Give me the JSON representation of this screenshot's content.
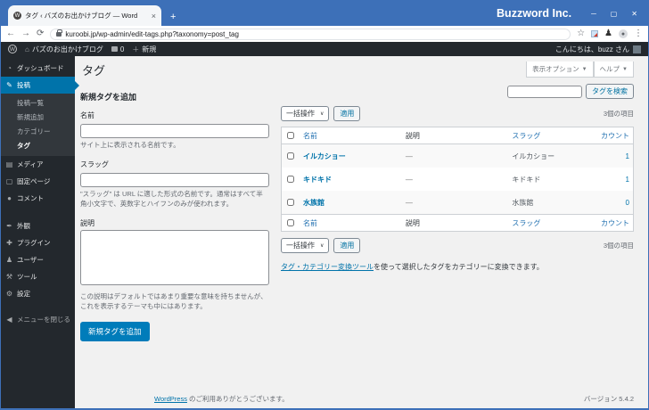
{
  "browser": {
    "tab_title": "タグ ‹ バズのお出かけブログ — Word",
    "window_title": "Buzzword Inc.",
    "url": "kuroobi.jp/wp-admin/edit-tags.php?taxonomy=post_tag"
  },
  "admin_bar": {
    "wp_initial": "W",
    "site_name": "バズのお出かけブログ",
    "comments_count": "0",
    "new_label": "新規",
    "greeting": "こんにちは、buzz さん"
  },
  "sidebar": {
    "items": [
      {
        "label": "ダッシュボード"
      },
      {
        "label": "投稿"
      },
      {
        "label": "メディア"
      },
      {
        "label": "固定ページ"
      },
      {
        "label": "コメント"
      },
      {
        "label": "外観"
      },
      {
        "label": "プラグイン"
      },
      {
        "label": "ユーザー"
      },
      {
        "label": "ツール"
      },
      {
        "label": "設定"
      }
    ],
    "posts_submenu": [
      "投稿一覧",
      "新規追加",
      "カテゴリー",
      "タグ"
    ],
    "collapse_label": "メニューを閉じる"
  },
  "page": {
    "title": "タグ",
    "screen_options_label": "表示オプション",
    "help_label": "ヘルプ",
    "search_button": "タグを検索"
  },
  "form": {
    "heading": "新規タグを追加",
    "name_label": "名前",
    "name_desc": "サイト上に表示される名前です。",
    "slug_label": "スラッグ",
    "slug_desc": "\"スラッグ\" は URL に適した形式の名前です。通常はすべて半角小文字で、英数字とハイフンのみが使われます。",
    "description_label": "説明",
    "description_desc": "この説明はデフォルトではあまり重要な意味を持ちませんが、これを表示するテーマも中にはあります。",
    "submit_label": "新規タグを追加"
  },
  "table": {
    "bulk_label": "一括操作",
    "apply_label": "適用",
    "items_count": "3個の項目",
    "columns": [
      "名前",
      "説明",
      "スラッグ",
      "カウント"
    ],
    "rows": [
      {
        "name": "イルカショー",
        "description": "—",
        "slug": "イルカショー",
        "count": "1"
      },
      {
        "name": "キドキド",
        "description": "—",
        "slug": "キドキド",
        "count": "1"
      },
      {
        "name": "水族館",
        "description": "—",
        "slug": "水族館",
        "count": "0"
      }
    ],
    "note_link": "タグ・カテゴリー変換ツール",
    "note_rest": "を使って選択したタグをカテゴリーに変換できます。"
  },
  "footer": {
    "thanks_link": "WordPress",
    "thanks_rest": " のご利用ありがとうございます。",
    "version": "バージョン 5.4.2"
  },
  "icons": {
    "back": "←",
    "forward": "→",
    "refresh": "⟳",
    "star": "☆",
    "extensions": "♟",
    "menu": "⋮",
    "minimize": "─",
    "maximize": "▢",
    "close": "✕",
    "tab_close": "×",
    "new_tab": "+",
    "home": "⌂",
    "plus": "＋",
    "dashboard": "◔",
    "posts": "✎",
    "media": "▤",
    "pages": "▢",
    "comments": "●",
    "appearance": "✒",
    "plugins": "✚",
    "users": "♟",
    "tools": "⚒",
    "settings": "⚙",
    "collapse": "◀",
    "chevron_down": "▼",
    "select_chevron": "∨",
    "person": "●"
  },
  "colors": {
    "titlebar": "#3d70b8",
    "admin_dark": "#23282d",
    "menu_highlight": "#0073aa",
    "primary_button": "#007cba",
    "link": "#0073aa",
    "content_bg": "#f1f1f1"
  }
}
